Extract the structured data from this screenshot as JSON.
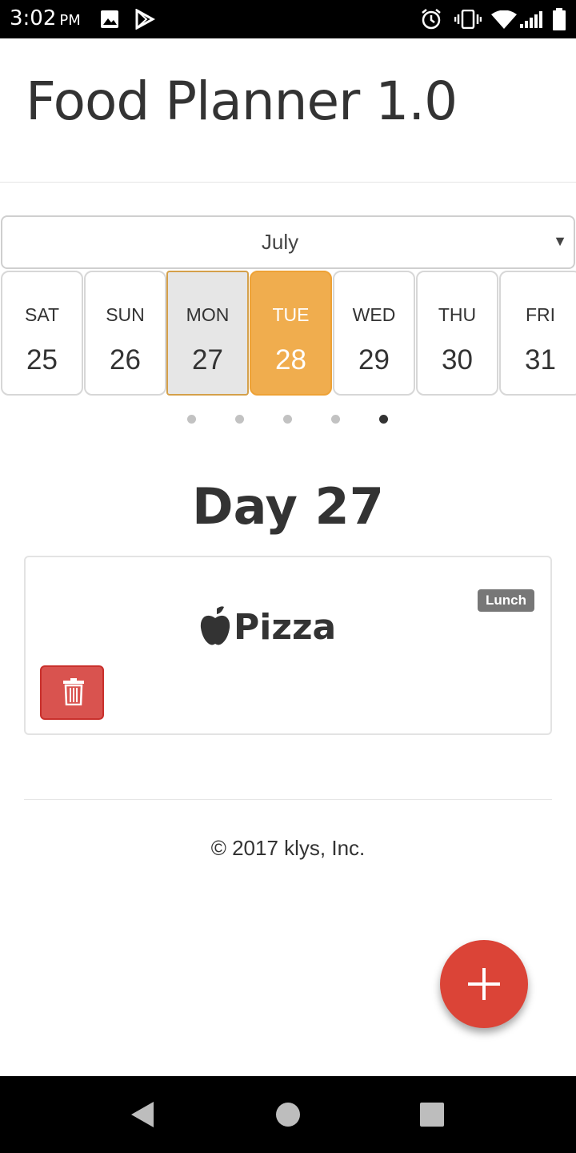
{
  "status_bar": {
    "time": "3:02",
    "ampm": "PM",
    "icons": [
      "image-icon",
      "play-store-icon",
      "alarm-icon",
      "vibrate-icon",
      "wifi-icon",
      "signal-icon",
      "battery-icon"
    ]
  },
  "header": {
    "title": "Food Planner 1.0"
  },
  "month_select": {
    "value": "July"
  },
  "days": [
    {
      "name": "SAT",
      "num": "25"
    },
    {
      "name": "SUN",
      "num": "26"
    },
    {
      "name": "MON",
      "num": "27",
      "state": "selected"
    },
    {
      "name": "TUE",
      "num": "28",
      "state": "today"
    },
    {
      "name": "WED",
      "num": "29"
    },
    {
      "name": "THU",
      "num": "30"
    },
    {
      "name": "FRI",
      "num": "31"
    }
  ],
  "pagination": {
    "total": 5,
    "active": 5
  },
  "day_heading": "Day 27",
  "meal": {
    "name": "Pizza",
    "badge": "Lunch",
    "icon": "apple-icon"
  },
  "footer": {
    "copyright": "© 2017 klys, Inc."
  },
  "colors": {
    "today": "#f0ad4e",
    "delete": "#d9534f",
    "fab": "#db4437"
  },
  "nav_bar": {
    "icons": [
      "back-icon",
      "home-icon",
      "recents-icon"
    ]
  }
}
